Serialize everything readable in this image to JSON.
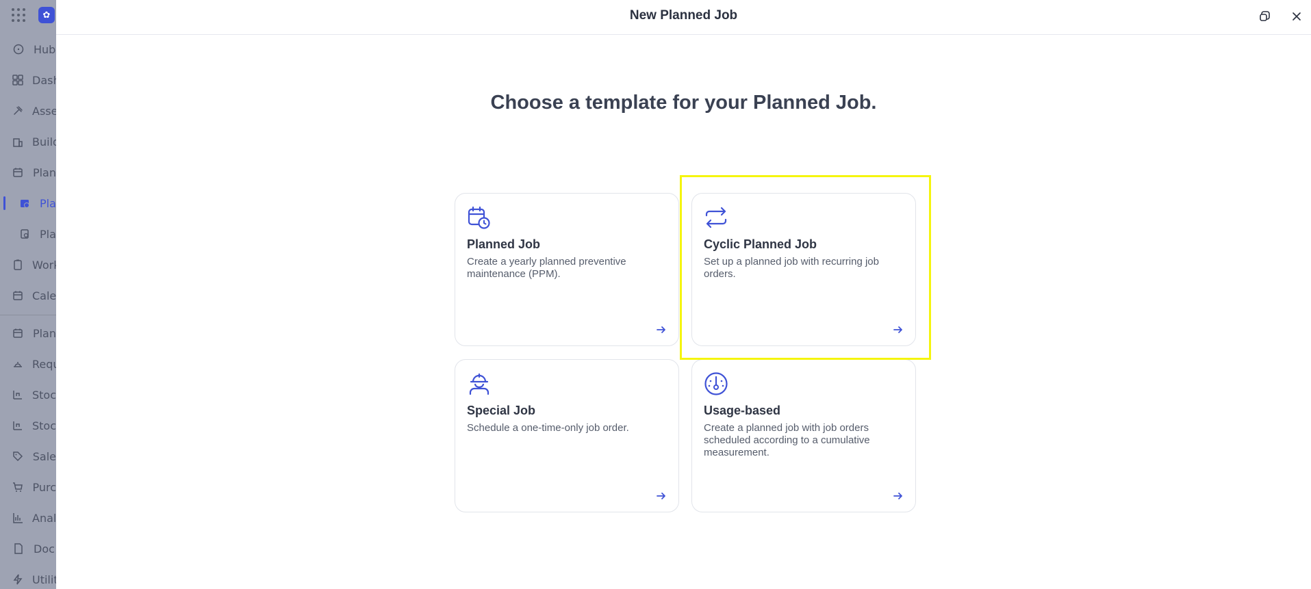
{
  "sidebar": {
    "items": [
      {
        "label": "Hub",
        "icon": "hub-icon"
      },
      {
        "label": "Dash",
        "icon": "dashboard-icon"
      },
      {
        "label": "Asse",
        "icon": "assets-icon"
      },
      {
        "label": "Build",
        "icon": "building-icon"
      },
      {
        "label": "Plan",
        "icon": "calendar-icon"
      },
      {
        "label": "Pla",
        "icon": "planned-job-icon",
        "active": true
      },
      {
        "label": "Pla",
        "icon": "planned-template-icon"
      },
      {
        "label": "Work",
        "icon": "work-order-icon"
      },
      {
        "label": "Cale",
        "icon": "calendar-icon"
      },
      {
        "label": "Plan",
        "icon": "calendar-icon"
      },
      {
        "label": "Requ",
        "icon": "request-icon"
      },
      {
        "label": "Stoc",
        "icon": "stock-icon"
      },
      {
        "label": "Stoc",
        "icon": "stock-icon"
      },
      {
        "label": "Sale",
        "icon": "tag-icon"
      },
      {
        "label": "Purc",
        "icon": "cart-icon"
      },
      {
        "label": "Anal",
        "icon": "chart-icon"
      },
      {
        "label": "Doc",
        "icon": "document-icon"
      },
      {
        "label": "Utilit",
        "icon": "bolt-icon"
      }
    ]
  },
  "modal": {
    "title": "New Planned Job",
    "heading": "Choose a template for your Planned Job."
  },
  "templates": [
    {
      "title": "Planned Job",
      "description": "Create a yearly planned preventive maintenance (PPM).",
      "icon": "calendar-clock-icon"
    },
    {
      "title": "Cyclic Planned Job",
      "description": "Set up a planned job with recurring job orders.",
      "icon": "repeat-arrows-icon",
      "highlighted": true
    },
    {
      "title": "Special Job",
      "description": "Schedule a one-time-only job order.",
      "icon": "worker-helmet-icon"
    },
    {
      "title": "Usage-based",
      "description": "Create a planned job with job orders scheduled according to a cumulative measurement.",
      "icon": "gauge-icon"
    }
  ],
  "colors": {
    "accent": "#3f52d6",
    "highlight": "#f5f50e",
    "overlay": "#9ea3b3"
  }
}
